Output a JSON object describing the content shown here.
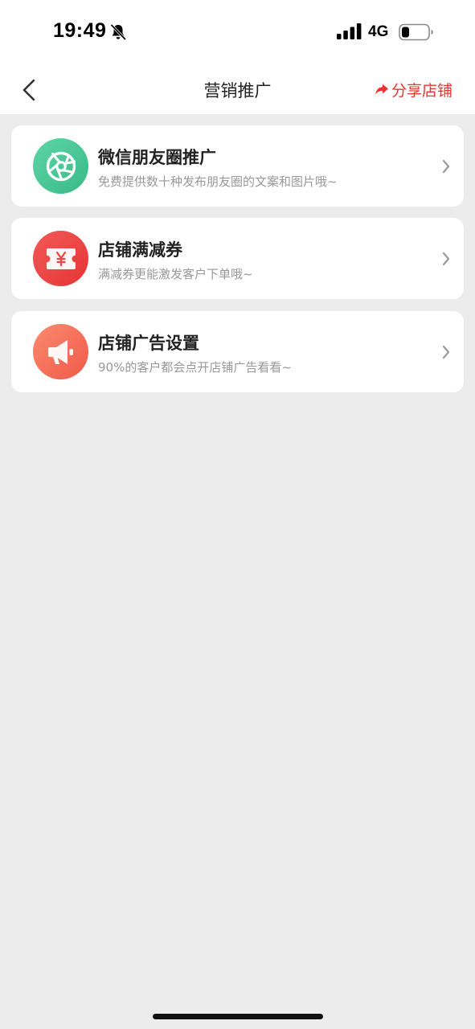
{
  "status_bar": {
    "time": "19:49",
    "network": "4G",
    "icons": [
      "bell-off-icon",
      "signal-icon",
      "battery-icon"
    ]
  },
  "nav": {
    "title": "营销推广",
    "share_label": "分享店铺",
    "back_icon": "chevron-left-icon",
    "share_icon": "share-arrow-icon"
  },
  "colors": {
    "accent": "#e5352f",
    "page_background": "#ececec",
    "card_background": "#ffffff",
    "moments_icon": "#45c598",
    "coupon_icon": "#ee4544",
    "ads_icon": "#f56a57"
  },
  "items": [
    {
      "title": "微信朋友圈推广",
      "desc": "免费提供数十种发布朋友圈的文案和图片哦~",
      "icon": "camera-aperture-icon"
    },
    {
      "title": "店铺满减券",
      "desc": "满减券更能激发客户下单哦~",
      "icon": "coupon-yen-icon"
    },
    {
      "title": "店铺广告设置",
      "desc": "90%的客户都会点开店铺广告看看~",
      "icon": "megaphone-icon"
    }
  ]
}
